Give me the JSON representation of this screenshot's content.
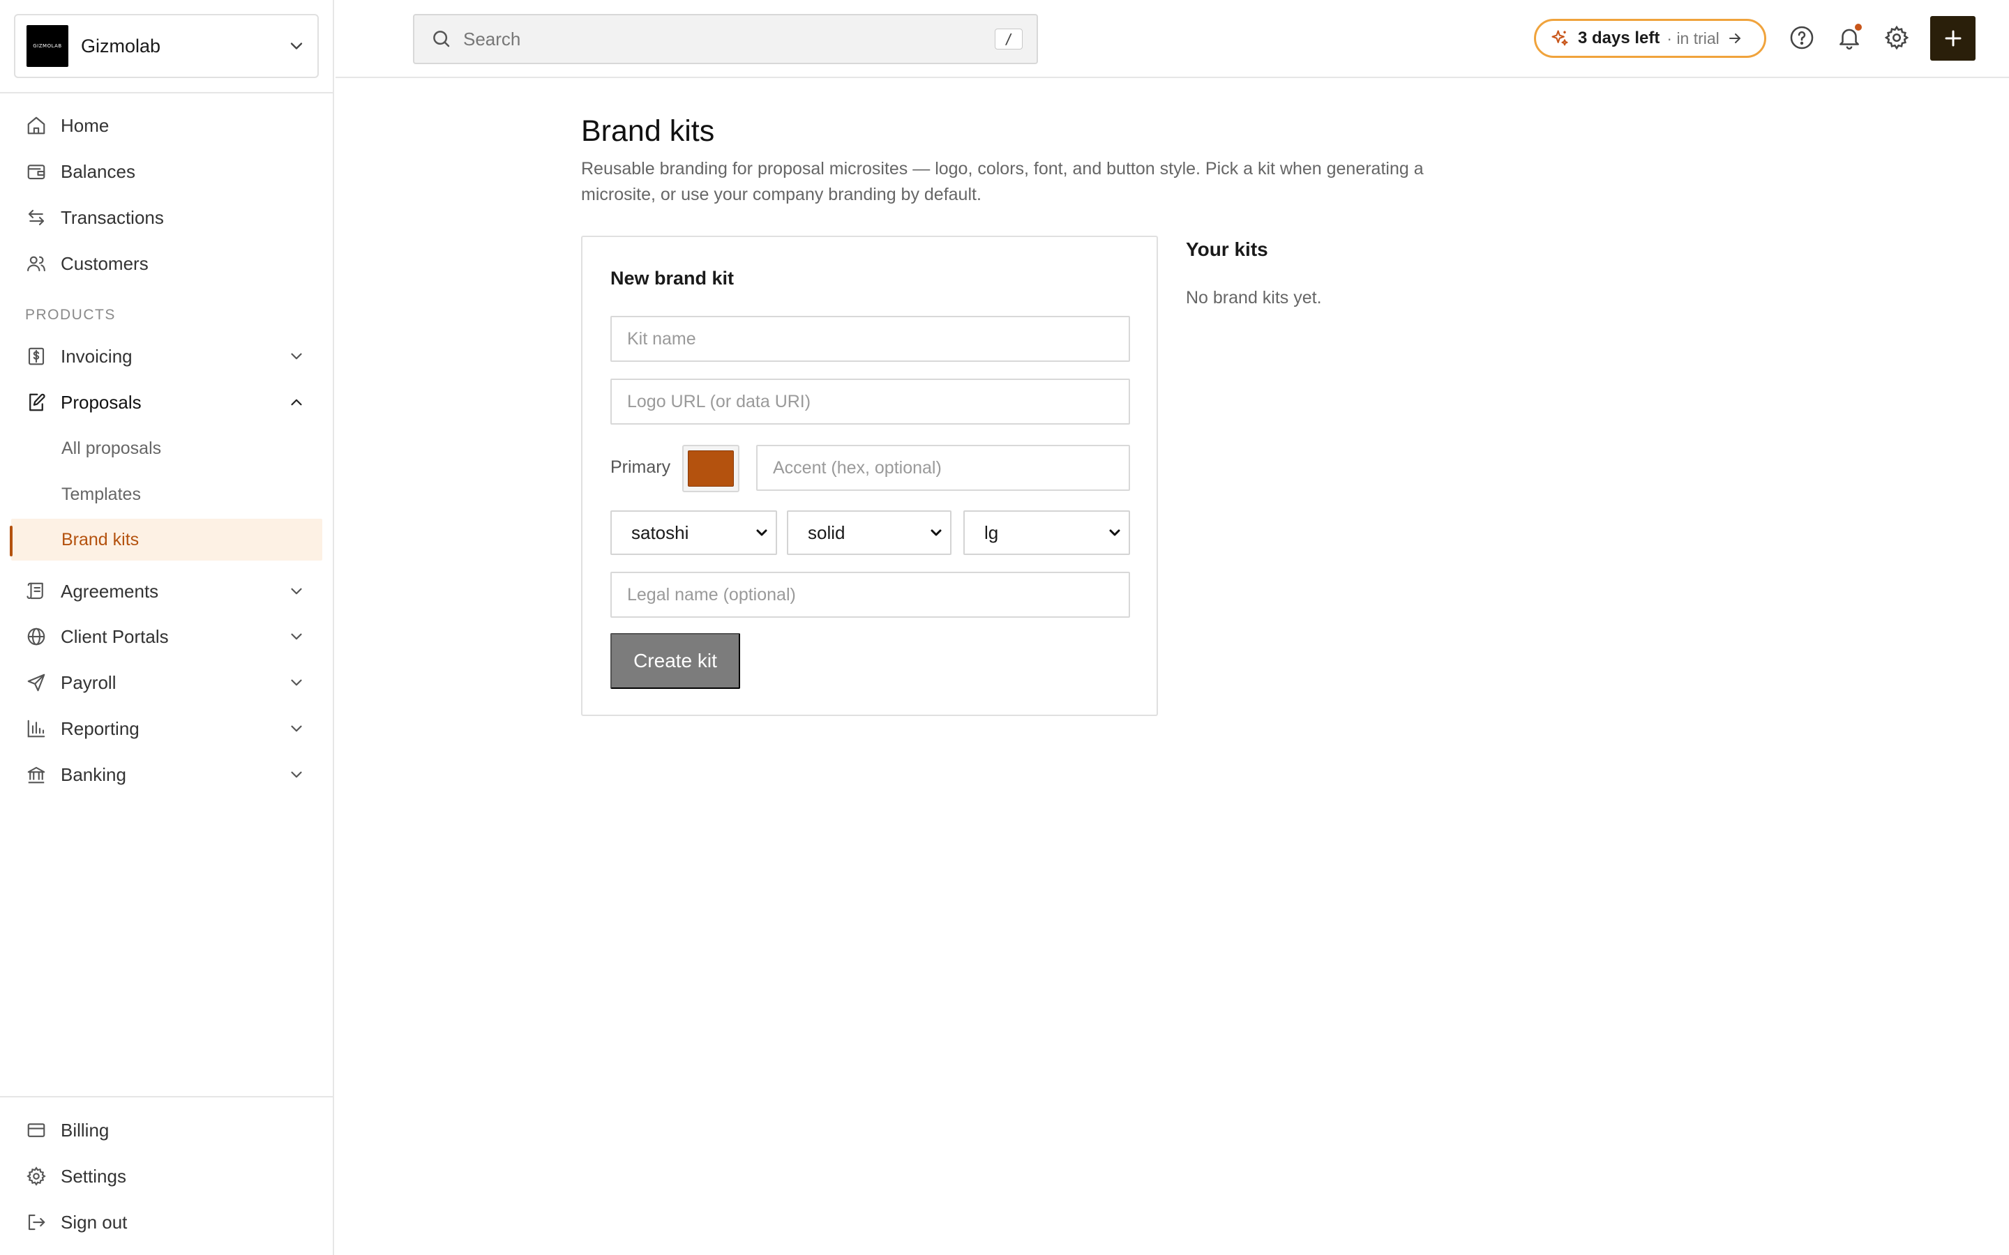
{
  "org": {
    "name": "Gizmolab",
    "logo_text": "GIZMOLAB"
  },
  "search": {
    "placeholder": "Search",
    "shortcut": "/"
  },
  "trial": {
    "highlight": "3 days left",
    "suffix": "· in trial"
  },
  "nav": {
    "home": "Home",
    "balances": "Balances",
    "transactions": "Transactions",
    "customers": "Customers",
    "products_section": "PRODUCTS",
    "invoicing": "Invoicing",
    "proposals": "Proposals",
    "proposals_sub": [
      "All proposals",
      "Templates",
      "Brand kits"
    ],
    "agreements": "Agreements",
    "client_portals": "Client Portals",
    "payroll": "Payroll",
    "reporting": "Reporting",
    "banking": "Banking",
    "billing": "Billing",
    "settings": "Settings",
    "sign_out": "Sign out"
  },
  "page": {
    "title": "Brand kits",
    "description": "Reusable branding for proposal microsites — logo, colors, font, and button style. Pick a kit when generating a microsite, or use your company branding by default."
  },
  "form": {
    "title": "New brand kit",
    "kit_name_placeholder": "Kit name",
    "logo_url_placeholder": "Logo URL (or data URI)",
    "primary_label": "Primary",
    "primary_color": "#b4520e",
    "accent_placeholder": "Accent (hex, optional)",
    "font_value": "satoshi",
    "button_style_value": "solid",
    "radius_value": "lg",
    "legal_name_placeholder": "Legal name (optional)",
    "submit_label": "Create kit"
  },
  "kits": {
    "title": "Your kits",
    "empty_text": "No brand kits yet."
  },
  "colors": {
    "accent": "#b4520e",
    "active_bg": "#fdf1e4",
    "trial_border": "#f0a33c",
    "plus_bg": "#2a1f0a"
  },
  "icons": [
    "home-icon",
    "wallet-icon",
    "arrows-icon",
    "users-icon",
    "dollar-doc-icon",
    "file-edit-icon",
    "scroll-icon",
    "globe-icon",
    "send-icon",
    "bar-chart-icon",
    "bank-icon",
    "credit-card-icon",
    "gear-icon",
    "sign-out-icon",
    "search-icon",
    "sparkle-icon",
    "help-icon",
    "bell-icon",
    "plus-icon"
  ]
}
